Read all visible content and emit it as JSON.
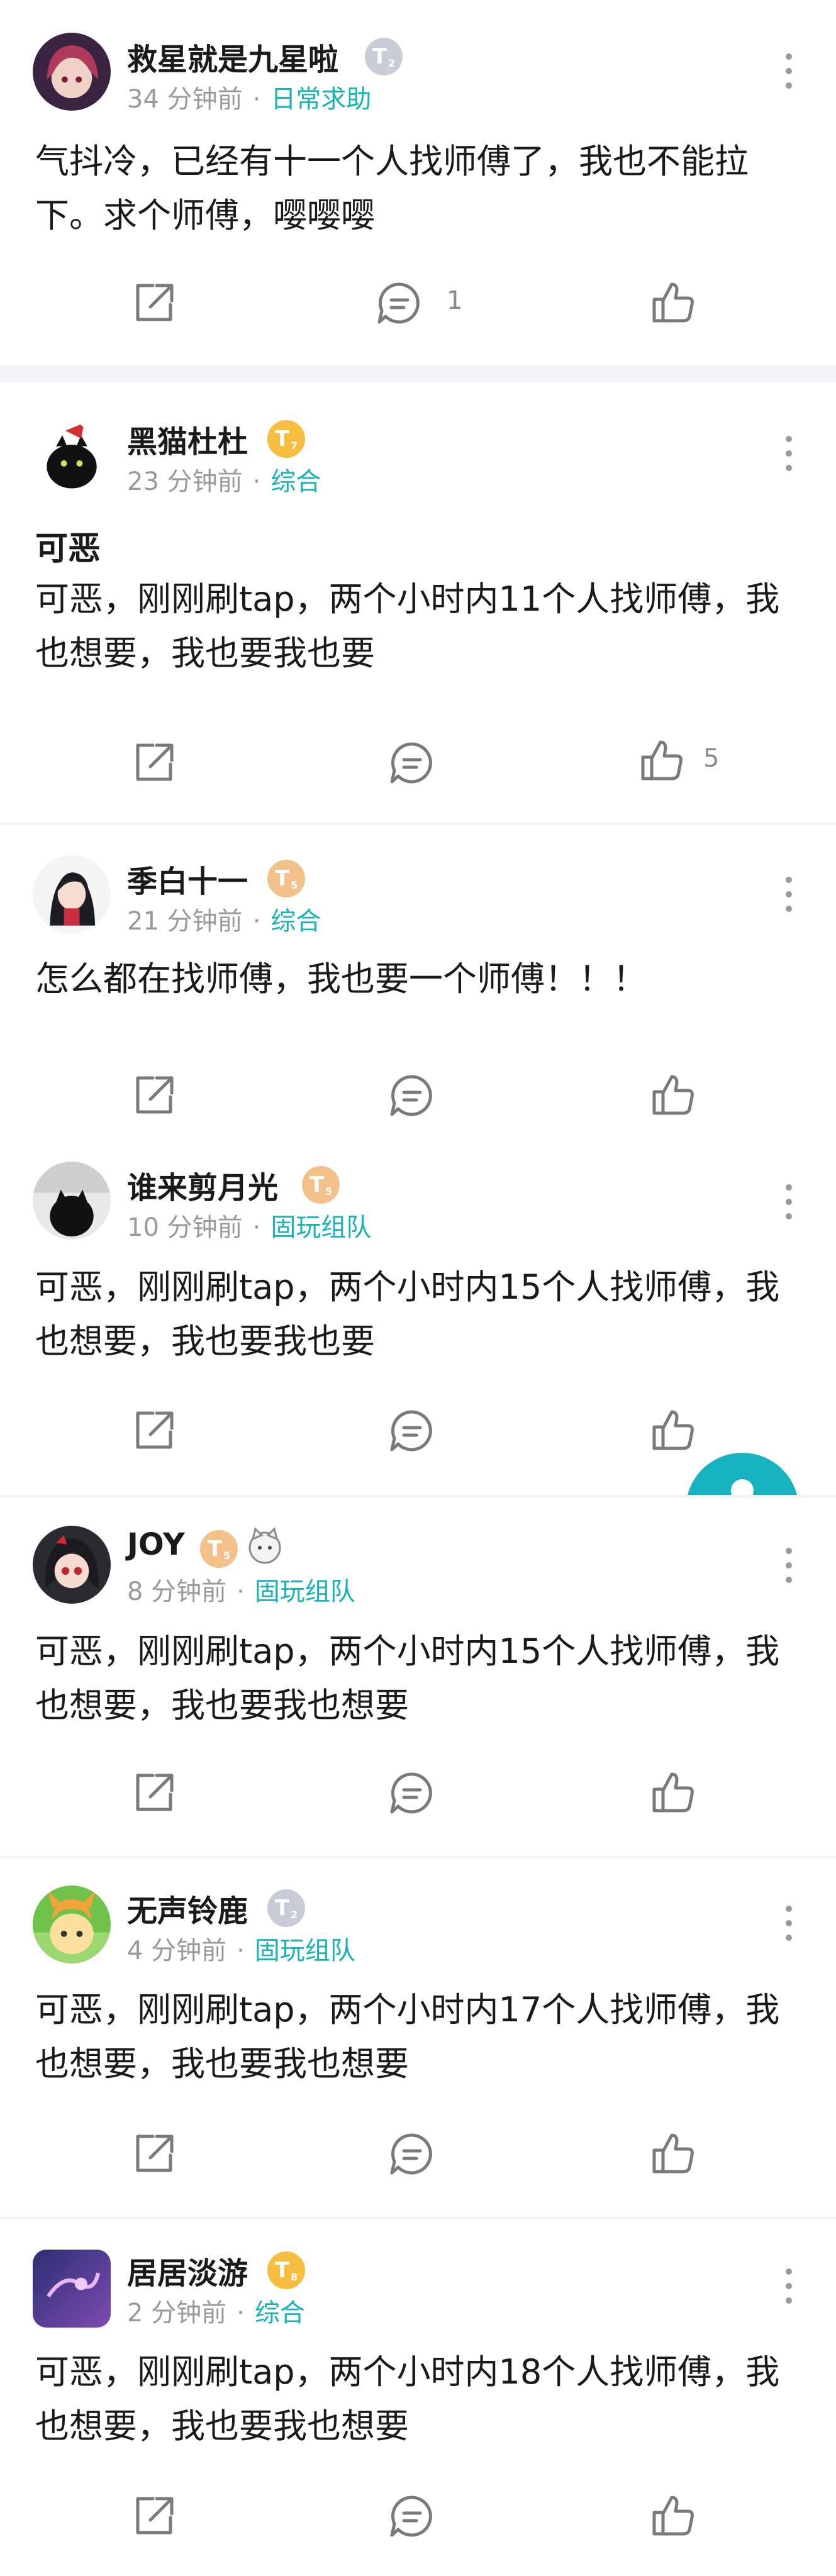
{
  "posts": [
    {
      "username": "救星就是九星啦",
      "time": "34 分钟前",
      "tag": "日常求助",
      "badge": "T",
      "badge_level": "2",
      "title": "",
      "body": "气抖冷，已经有十一个人找师傅了，我也不能拉下。求个师傅，嘤嘤嘤",
      "comment_count": "1",
      "like_count": ""
    },
    {
      "username": "黑猫杜杜",
      "time": "23 分钟前",
      "tag": "综合",
      "badge": "T",
      "badge_level": "7",
      "title": "可恶",
      "body": "可恶，刚刚刷tap，两个小时内11个人找师傅，我也想要，我也要我也要",
      "comment_count": "",
      "like_count": "5"
    },
    {
      "username": "季白十一",
      "time": "21 分钟前",
      "tag": "综合",
      "badge": "T",
      "badge_level": "5",
      "title": "",
      "body": "怎么都在找师傅，我也要一个师傅！！！",
      "comment_count": "",
      "like_count": ""
    },
    {
      "username": "谁来剪月光",
      "time": "10 分钟前",
      "tag": "固玩组队",
      "badge": "T",
      "badge_level": "5",
      "title": "",
      "body": "可恶，刚刚刷tap，两个小时内15个人找师傅，我也想要，我也要我也要",
      "comment_count": "",
      "like_count": ""
    },
    {
      "username": "JOY",
      "time": "8 分钟前",
      "tag": "固玩组队",
      "badge": "T",
      "badge_level": "5",
      "title": "",
      "body": "可恶，刚刚刷tap，两个小时内15个人找师傅，我也想要，我也要我也想要",
      "comment_count": "",
      "like_count": ""
    },
    {
      "username": "无声铃鹿",
      "time": "4 分钟前",
      "tag": "固玩组队",
      "badge": "T",
      "badge_level": "2",
      "title": "",
      "body": "可恶，刚刚刷tap，两个小时内17个人找师傅，我也想要，我也要我也想要",
      "comment_count": "",
      "like_count": ""
    },
    {
      "username": "居居淡游",
      "time": "2 分钟前",
      "tag": "综合",
      "badge": "T",
      "badge_level": "8",
      "title": "",
      "body": "可恶，刚刚刷tap，两个小时内18个人找师傅，我也想要，我也要我也想要",
      "comment_count": "",
      "like_count": ""
    }
  ],
  "colors": {
    "tag": "#18b3b8",
    "meta": "#9a9a9a",
    "icon": "#7a7a7a",
    "separator": "#f3f4f6",
    "fab": "#18b3c0"
  },
  "icons": {
    "share": "share-icon",
    "comment": "comment-icon",
    "like": "thumbs-up-icon",
    "more": "more-vertical-icon"
  }
}
